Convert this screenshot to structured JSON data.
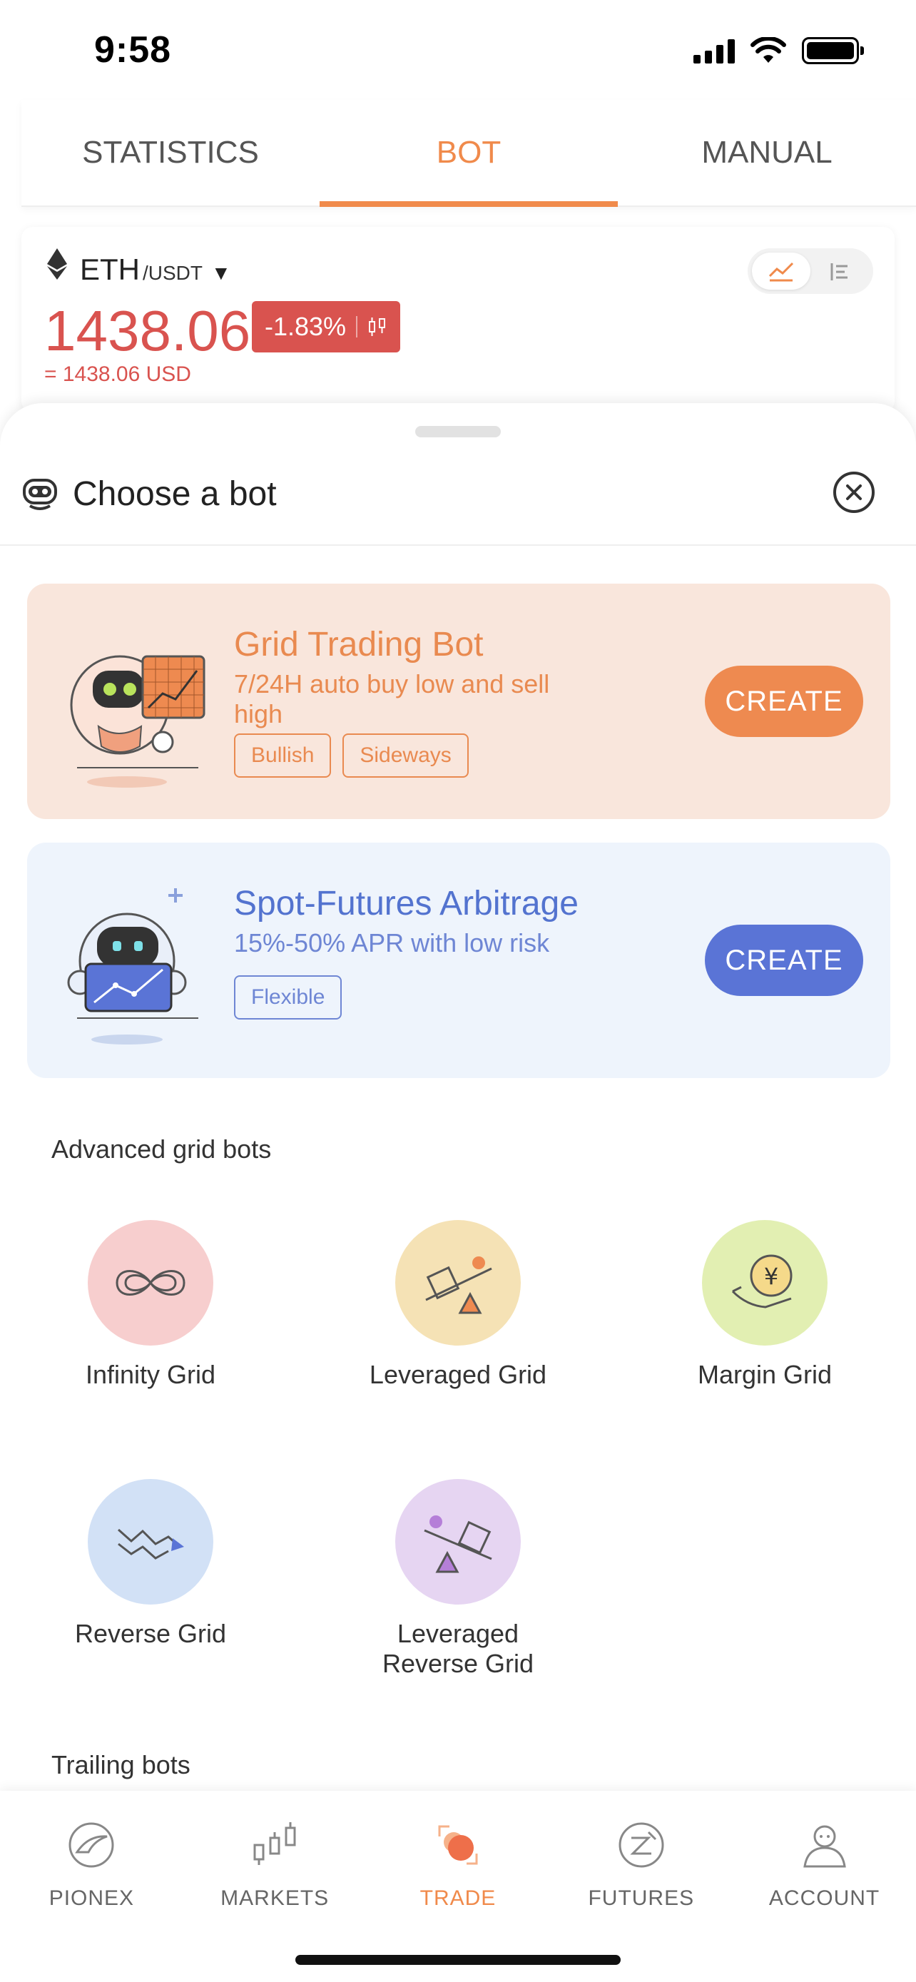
{
  "status_bar": {
    "time": "9:58"
  },
  "top_tabs": [
    {
      "label": "STATISTICS",
      "active": false
    },
    {
      "label": "BOT",
      "active": true
    },
    {
      "label": "MANUAL",
      "active": false
    }
  ],
  "ticker": {
    "base": "ETH",
    "quote": "/USDT",
    "caret": "▼",
    "price": "1438.06",
    "change": "-1.83%",
    "usd_price": "= 1438.06 USD",
    "down_color": "#D9534F"
  },
  "sheet": {
    "title": "Choose a bot",
    "bots": [
      {
        "title": "Grid Trading Bot",
        "description": "7/24H auto buy low and sell high",
        "tags": [
          "Bullish",
          "Sideways"
        ],
        "button": "CREATE",
        "accent": "#EE8A50"
      },
      {
        "title": "Spot-Futures Arbitrage",
        "description": "15%-50% APR with low risk",
        "tags": [
          "Flexible"
        ],
        "button": "CREATE",
        "accent": "#5A74D6"
      }
    ],
    "advanced_title": "Advanced grid bots",
    "advanced": [
      {
        "label": "Infinity Grid",
        "icon": "infinity-icon",
        "color": "#F7CECE"
      },
      {
        "label": "Leveraged Grid",
        "icon": "seesaw-icon",
        "color": "#F5E2B5"
      },
      {
        "label": "Margin Grid",
        "icon": "coin-hand-icon",
        "color": "#E2EFB2"
      },
      {
        "label": "Reverse Grid",
        "icon": "down-trend-icon",
        "color": "#D2E1F6"
      },
      {
        "label": "Leveraged Reverse Grid",
        "icon": "reverse-seesaw-icon",
        "color": "#E6D5F2"
      }
    ],
    "trailing_title": "Trailing bots"
  },
  "bottom_nav": [
    {
      "label": "PIONEX",
      "icon": "pionex-logo-icon",
      "active": false
    },
    {
      "label": "MARKETS",
      "icon": "candles-icon",
      "active": false
    },
    {
      "label": "TRADE",
      "icon": "trade-icon",
      "active": true
    },
    {
      "label": "FUTURES",
      "icon": "futures-icon",
      "active": false
    },
    {
      "label": "ACCOUNT",
      "icon": "person-icon",
      "active": false
    }
  ]
}
